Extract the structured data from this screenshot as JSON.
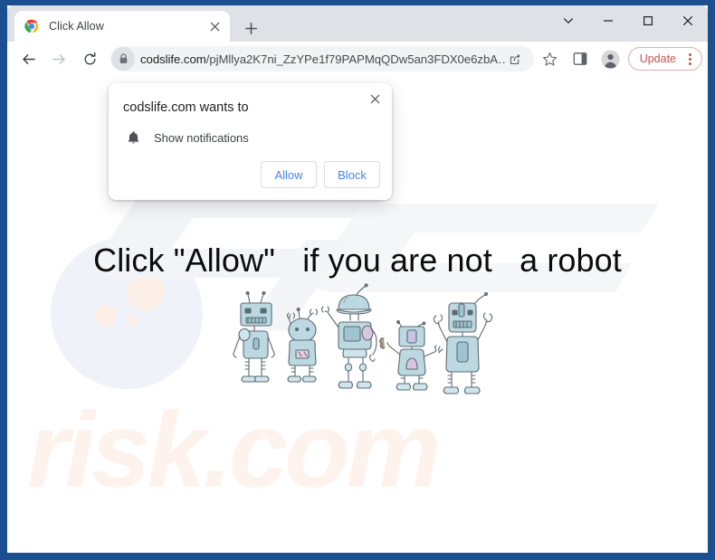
{
  "window": {
    "controls": [
      {
        "name": "tab-search",
        "glyph": "chevron-down"
      },
      {
        "name": "minimize",
        "glyph": "minimize"
      },
      {
        "name": "maximize",
        "glyph": "maximize"
      },
      {
        "name": "close",
        "glyph": "close"
      }
    ]
  },
  "tabstrip": {
    "tab": {
      "title": "Click Allow",
      "favicon": "chrome-logo-icon",
      "close_label": "×"
    },
    "new_tab_label": "+"
  },
  "toolbar": {
    "back_icon": "back-arrow-icon",
    "forward_icon": "forward-arrow-icon",
    "reload_icon": "reload-icon",
    "lock_icon": "lock-icon",
    "url_host": "codslife.com",
    "url_path": "/pjMllya2K7ni_ZzYPe1f79PAPMqQDw5an3FDX0e6zbA…",
    "url_full": "codslife.com/pjMllya2K7ni_ZzYPe1f79PAPMqQDw5an3FDX0e6zbA…",
    "share_icon": "share-icon",
    "bookmark_icon": "star-icon",
    "sidepanel_icon": "side-panel-icon",
    "profile_icon": "profile-avatar-icon",
    "update_label": "Update",
    "update_color": "#c5534f",
    "menu_icon": "three-dot-menu-icon"
  },
  "permission_dialog": {
    "title": "codslife.com wants to",
    "permission_icon": "bell-icon",
    "permission_label": "Show notifications",
    "allow_label": "Allow",
    "block_label": "Block",
    "close_label": "×",
    "button_text_color": "#4285f4"
  },
  "page": {
    "headline": "Click \"Allow\"   if you are not   a robot",
    "illustration": "five-cartoon-robots-illustration",
    "watermark_text": "risk.com",
    "watermark_color": "#fdf3ec",
    "background_color": "#ffffff"
  }
}
